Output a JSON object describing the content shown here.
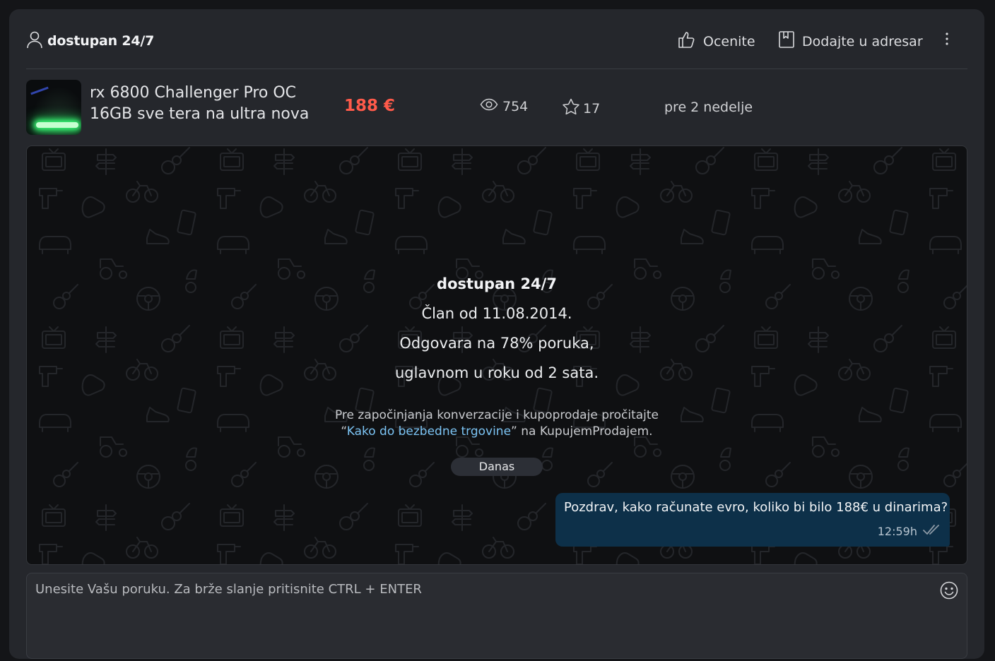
{
  "header": {
    "user_name": "dostupan 24/7",
    "rate_label": "Ocenite",
    "address_book_label": "Dodajte u adresar"
  },
  "listing": {
    "title_line1": "rx 6800 Challenger Pro OC",
    "title_line2": "16GB sve tera na ultra nova",
    "price": "188 €",
    "views": "754",
    "favorites": "17",
    "posted": "pre 2 nedelje"
  },
  "chat": {
    "seller_name": "dostupan 24/7",
    "member_since": "Član od 11.08.2014.",
    "response_rate": "Odgovara na 78% poruka,",
    "response_time": "uglavnom u roku od 2 sata.",
    "safety_prefix": "Pre započinjanja konverzacije i kupoprodaje pročitajte",
    "safety_quote_open": "“",
    "safety_link": "Kako do bezbedne trgovine",
    "safety_suffix": "” na KupujemProdajem.",
    "day_divider": "Danas",
    "messages": [
      {
        "text": "Pozdrav, kako računate evro, koliko bi bilo 188€ u dinarima?",
        "time": "12:59h",
        "status_icon": "double-check-icon"
      }
    ]
  },
  "composer": {
    "placeholder": "Unesite Vašu poruku. Za brže slanje pritisnite CTRL + ENTER",
    "emoji_icon": "smiley-icon"
  },
  "colors": {
    "page_bg": "#141518",
    "panel_bg": "#25272c",
    "chat_bg": "#0f1012",
    "price": "#ff5a4a",
    "link": "#7cc4f4",
    "bubble_bg": "#0d3049"
  }
}
